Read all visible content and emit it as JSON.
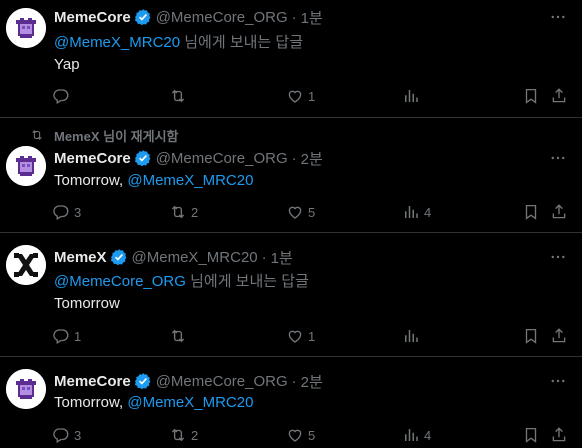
{
  "tweets": [
    {
      "name": "MemeCore",
      "handle": "@MemeCore_ORG",
      "dot": "·",
      "time": "1분",
      "reply_mention": "@MemeX_MRC20",
      "reply_suffix": " 님에게 보내는 답글",
      "body": "Yap",
      "replies": "",
      "reposts": "",
      "likes": "1",
      "views": ""
    },
    {
      "repost_context": "MemeX 님이 재게시함",
      "name": "MemeCore",
      "handle": "@MemeCore_ORG",
      "dot": "·",
      "time": "2분",
      "body_prefix": "Tomorrow, ",
      "body_mention": "@MemeX_MRC20",
      "replies": "3",
      "reposts": "2",
      "likes": "5",
      "views": "4"
    },
    {
      "name": "MemeX",
      "handle": "@MemeX_MRC20",
      "dot": "·",
      "time": "1분",
      "reply_mention": "@MemeCore_ORG",
      "reply_suffix": " 님에게 보내는 답글",
      "body": "Tomorrow",
      "replies": "1",
      "reposts": "",
      "likes": "1",
      "views": ""
    },
    {
      "name": "MemeCore",
      "handle": "@MemeCore_ORG",
      "dot": "·",
      "time": "2분",
      "body_prefix": "Tomorrow, ",
      "body_mention": "@MemeX_MRC20",
      "replies": "3",
      "reposts": "2",
      "likes": "5",
      "views": "4"
    }
  ],
  "colors": {
    "background": "#000000",
    "text": "#e7e9ea",
    "muted": "#71767b",
    "accent": "#1d9bf0",
    "divider": "#2f3336",
    "memecore_purple": "#6b3fa0"
  },
  "icons": [
    "reply-icon",
    "repost-icon",
    "like-icon",
    "views-icon",
    "bookmark-icon",
    "share-icon",
    "more-icon",
    "verified-badge-icon"
  ]
}
